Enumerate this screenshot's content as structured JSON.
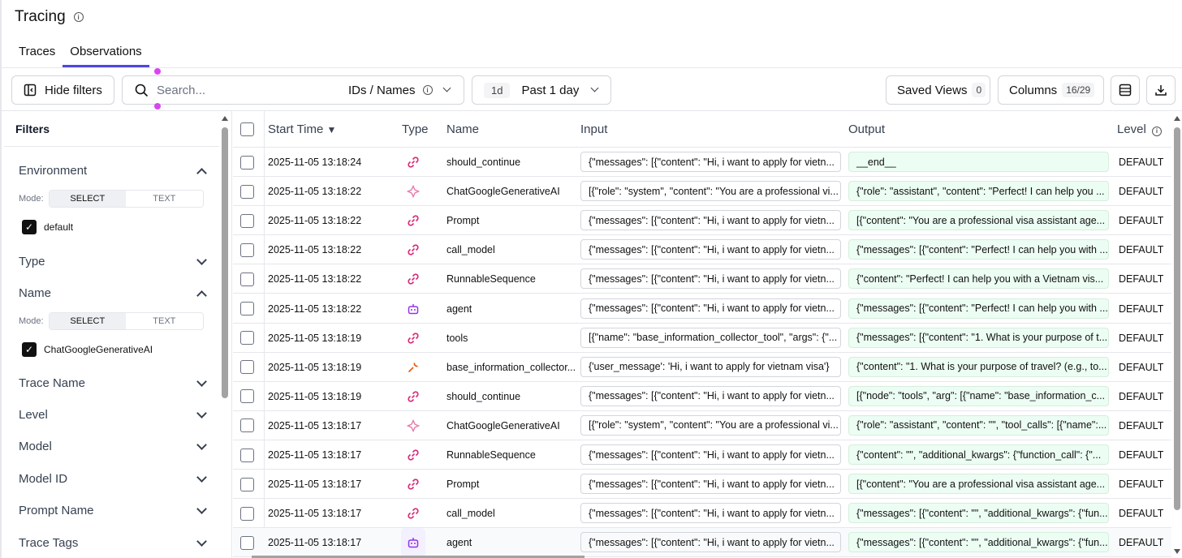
{
  "page": {
    "title": "Tracing"
  },
  "tabs": [
    {
      "label": "Traces"
    },
    {
      "label": "Observations"
    }
  ],
  "toolbar": {
    "hide_filters": "Hide filters",
    "search_placeholder": "Search...",
    "search_scope": "IDs / Names",
    "date_badge": "1d",
    "date_range": "Past 1 day",
    "saved_views": "Saved Views",
    "saved_views_count": "0",
    "columns": "Columns",
    "columns_count": "16/29"
  },
  "sidebar": {
    "title": "Filters",
    "mode_label": "Mode:",
    "mode_select": "SELECT",
    "mode_text": "TEXT",
    "sections": [
      {
        "label": "Environment"
      },
      {
        "label": "Type"
      },
      {
        "label": "Name"
      },
      {
        "label": "Trace Name"
      },
      {
        "label": "Level"
      },
      {
        "label": "Model"
      },
      {
        "label": "Model ID"
      },
      {
        "label": "Prompt Name"
      },
      {
        "label": "Trace Tags"
      }
    ],
    "env_value": "default",
    "name_value": "ChatGoogleGenerativeAI"
  },
  "table": {
    "headers": {
      "start_time": "Start Time",
      "type": "Type",
      "name": "Name",
      "input": "Input",
      "output": "Output",
      "level": "Level"
    },
    "rows": [
      {
        "time": "2025-11-05 13:18:24",
        "icon": "chain-icon",
        "name": "should_continue",
        "input": "{\"messages\": [{\"content\": \"Hi, i want to apply for vietn...",
        "output": "__end__",
        "level": "DEFAULT"
      },
      {
        "time": "2025-11-05 13:18:22",
        "icon": "generation-icon",
        "name": "ChatGoogleGenerativeAI",
        "input": "[{\"role\": \"system\", \"content\": \"You are a professional vi...",
        "output": "{\"role\": \"assistant\", \"content\": \"Perfect! I can help you ...",
        "level": "DEFAULT"
      },
      {
        "time": "2025-11-05 13:18:22",
        "icon": "chain-icon",
        "name": "Prompt",
        "input": "{\"messages\": [{\"content\": \"Hi, i want to apply for vietn...",
        "output": "[{\"content\": \"You are a professional visa assistant age...",
        "level": "DEFAULT"
      },
      {
        "time": "2025-11-05 13:18:22",
        "icon": "chain-icon",
        "name": "call_model",
        "input": "{\"messages\": [{\"content\": \"Hi, i want to apply for vietn...",
        "output": "{\"messages\": [{\"content\": \"Perfect! I can help you with ...",
        "level": "DEFAULT"
      },
      {
        "time": "2025-11-05 13:18:22",
        "icon": "chain-icon",
        "name": "RunnableSequence",
        "input": "{\"messages\": [{\"content\": \"Hi, i want to apply for vietn...",
        "output": "{\"content\": \"Perfect! I can help you with a Vietnam vis...",
        "level": "DEFAULT"
      },
      {
        "time": "2025-11-05 13:18:22",
        "icon": "agent-icon",
        "name": "agent",
        "input": "{\"messages\": [{\"content\": \"Hi, i want to apply for vietn...",
        "output": "{\"messages\": [{\"content\": \"Perfect! I can help you with ...",
        "level": "DEFAULT"
      },
      {
        "time": "2025-11-05 13:18:19",
        "icon": "chain-icon",
        "name": "tools",
        "input": "[{\"name\": \"base_information_collector_tool\", \"args\": {\"...",
        "output": "{\"messages\": [{\"content\": \"1. What is your purpose of t...",
        "level": "DEFAULT"
      },
      {
        "time": "2025-11-05 13:18:19",
        "icon": "tool-icon",
        "name": "base_information_collector...",
        "input": "{'user_message': 'Hi, i want to apply for vietnam visa'}",
        "output": "{\"content\": \"1. What is your purpose of travel? (e.g., to...",
        "level": "DEFAULT"
      },
      {
        "time": "2025-11-05 13:18:19",
        "icon": "chain-icon",
        "name": "should_continue",
        "input": "{\"messages\": [{\"content\": \"Hi, i want to apply for vietn...",
        "output": "[{\"node\": \"tools\", \"arg\": [{\"name\": \"base_information_c...",
        "level": "DEFAULT"
      },
      {
        "time": "2025-11-05 13:18:17",
        "icon": "generation-icon",
        "name": "ChatGoogleGenerativeAI",
        "input": "[{\"role\": \"system\", \"content\": \"You are a professional vi...",
        "output": "{\"role\": \"assistant\", \"content\": \"\", \"tool_calls\": [{\"name\":...",
        "level": "DEFAULT"
      },
      {
        "time": "2025-11-05 13:18:17",
        "icon": "chain-icon",
        "name": "RunnableSequence",
        "input": "{\"messages\": [{\"content\": \"Hi, i want to apply for vietn...",
        "output": "{\"content\": \"\", \"additional_kwargs\": {\"function_call\": {\"...",
        "level": "DEFAULT"
      },
      {
        "time": "2025-11-05 13:18:17",
        "icon": "chain-icon",
        "name": "Prompt",
        "input": "{\"messages\": [{\"content\": \"Hi, i want to apply for vietn...",
        "output": "[{\"content\": \"You are a professional visa assistant age...",
        "level": "DEFAULT"
      },
      {
        "time": "2025-11-05 13:18:17",
        "icon": "chain-icon",
        "name": "call_model",
        "input": "{\"messages\": [{\"content\": \"Hi, i want to apply for vietn...",
        "output": "{\"messages\": [{\"content\": \"\", \"additional_kwargs\": {\"fun...",
        "level": "DEFAULT"
      },
      {
        "time": "2025-11-05 13:18:17",
        "icon": "agent-icon",
        "name": "agent",
        "input": "{\"messages\": [{\"content\": \"Hi, i want to apply for vietn...",
        "output": "{\"messages\": [{\"content\": \"\", \"additional_kwargs\": {\"fun...",
        "level": "DEFAULT"
      }
    ]
  },
  "colors": {
    "accent": "#4f46e5",
    "chain": "#db2777",
    "generation": "#e879a8",
    "agent": "#9333ea",
    "tool": "#ea580c",
    "output_bg": "#ecfdf3"
  }
}
